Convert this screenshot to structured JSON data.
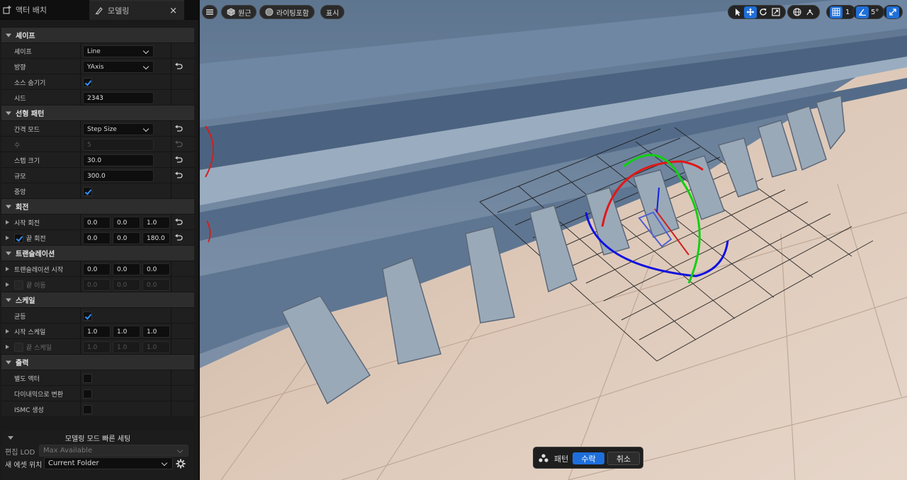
{
  "tabs": {
    "place_actors": "액터 배치",
    "modeling": "모델링",
    "close": "×"
  },
  "properties": {
    "shape_section": {
      "title": "셰이프",
      "shape_label": "셰이프",
      "shape_value": "Line",
      "direction_label": "방향",
      "direction_value": "YAxis",
      "hide_source_label": "소스 숨기기",
      "seed_label": "시드",
      "seed_value": "2343"
    },
    "linear_section": {
      "title": "선형 패턴",
      "spacing_mode_label": "간격 모드",
      "spacing_mode_value": "Step Size",
      "count_label": "수",
      "count_value": "5",
      "step_size_label": "스텝 크기",
      "step_size_value": "30.0",
      "extent_label": "규모",
      "extent_value": "300.0",
      "centered_label": "중앙"
    },
    "rotation_section": {
      "title": "회전",
      "start_label": "시작 회전",
      "start_values": [
        "0.0",
        "0.0",
        "1.0"
      ],
      "end_label": "끝 회전",
      "end_values": [
        "0.0",
        "0.0",
        "180.0"
      ]
    },
    "translation_section": {
      "title": "트랜슬레이션",
      "start_label": "트랜슬레이션 시작",
      "start_values": [
        "0.0",
        "0.0",
        "0.0"
      ],
      "end_label": "끝 이동",
      "end_values": [
        "0.0",
        "0.0",
        "0.0"
      ]
    },
    "scale_section": {
      "title": "스케일",
      "uniform_label": "균등",
      "start_label": "시작 스케일",
      "start_values": [
        "1.0",
        "1.0",
        "1.0"
      ],
      "end_label": "끝 스케일",
      "end_values": [
        "1.0",
        "1.0",
        "1.0"
      ]
    },
    "output_section": {
      "title": "출력",
      "separate_actors_label": "별도 액터",
      "convert_dynamic_label": "다이내믹으로 변환",
      "create_ismc_label": "ISMC 생성"
    }
  },
  "quick_settings": {
    "title": "모델링 모드 빠른 세팅",
    "edit_lod_label": "편집 LOD",
    "edit_lod_value": "Max Available",
    "new_asset_label": "새 에셋 위치",
    "new_asset_value": "Current Folder"
  },
  "viewport": {
    "perspective": "원근",
    "lit": "라이팅포함",
    "show": "표시",
    "grid_snap_value": "1",
    "rotation_snap_value": "5°"
  },
  "accept_bar": {
    "label": "패턴",
    "accept": "수락",
    "cancel": "취소"
  }
}
